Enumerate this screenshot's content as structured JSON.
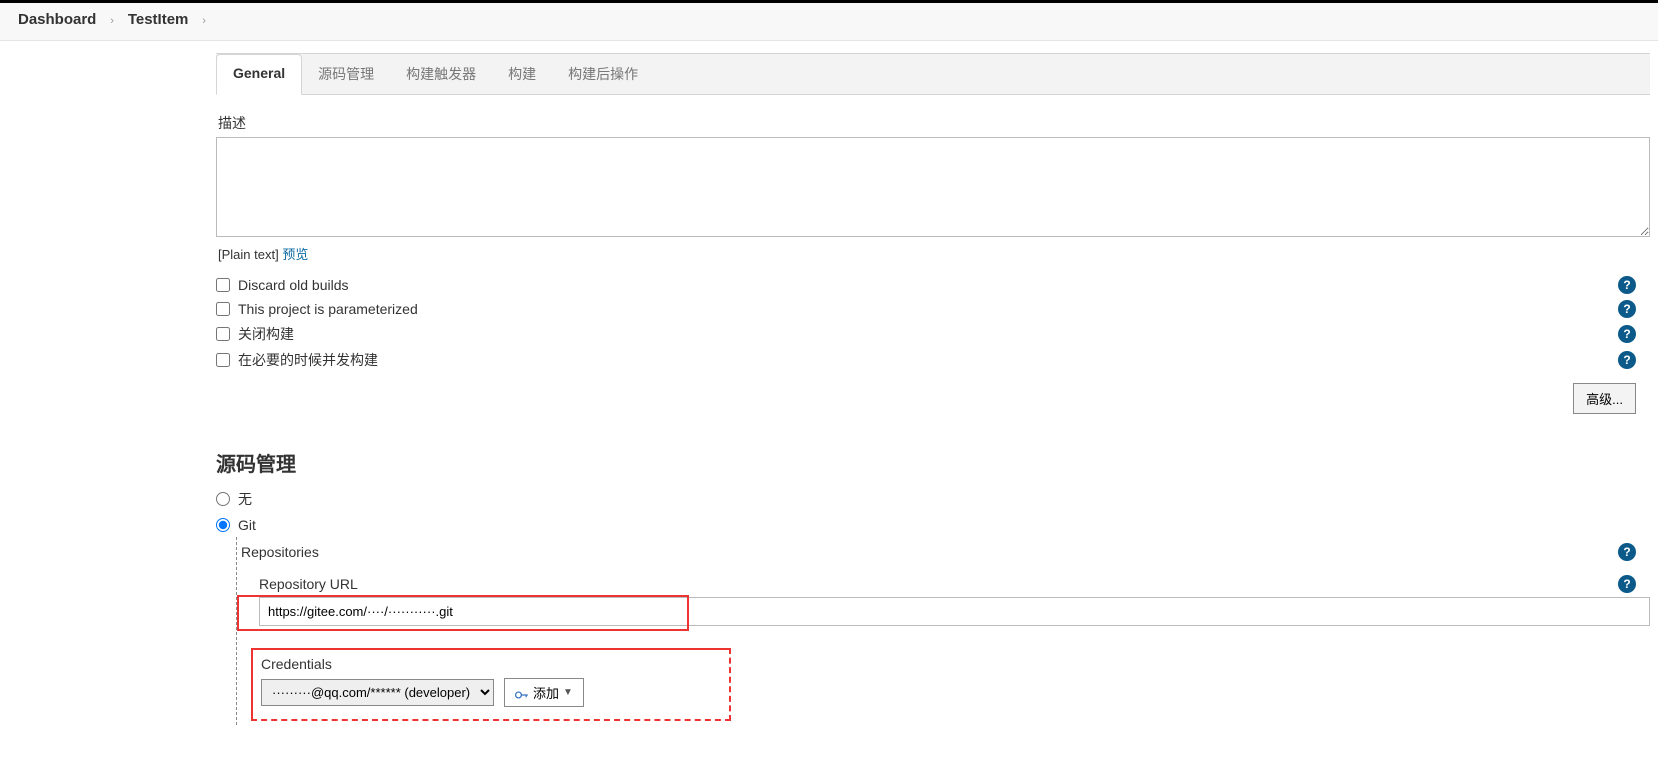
{
  "breadcrumb": {
    "dashboard": "Dashboard",
    "item": "TestItem"
  },
  "tabs": {
    "general": "General",
    "scm": "源码管理",
    "triggers": "构建触发器",
    "build": "构建",
    "post": "构建后操作"
  },
  "general": {
    "desc_label": "描述",
    "desc_value": "",
    "plain_text_prefix": "[Plain text] ",
    "preview": "预览",
    "discard": "Discard old builds",
    "parameterized": "This project is parameterized",
    "disable_build": "关闭构建",
    "concurrent": "在必要的时候并发构建",
    "advanced": "高级..."
  },
  "scm": {
    "title": "源码管理",
    "none": "无",
    "git": "Git",
    "repositories": "Repositories",
    "repo_url_label": "Repository URL",
    "repo_url_value": "https://gitee.com/····/···········.git",
    "credentials_label": "Credentials",
    "credentials_value": "·········@qq.com/****** (developer)",
    "add_btn": "添加"
  }
}
